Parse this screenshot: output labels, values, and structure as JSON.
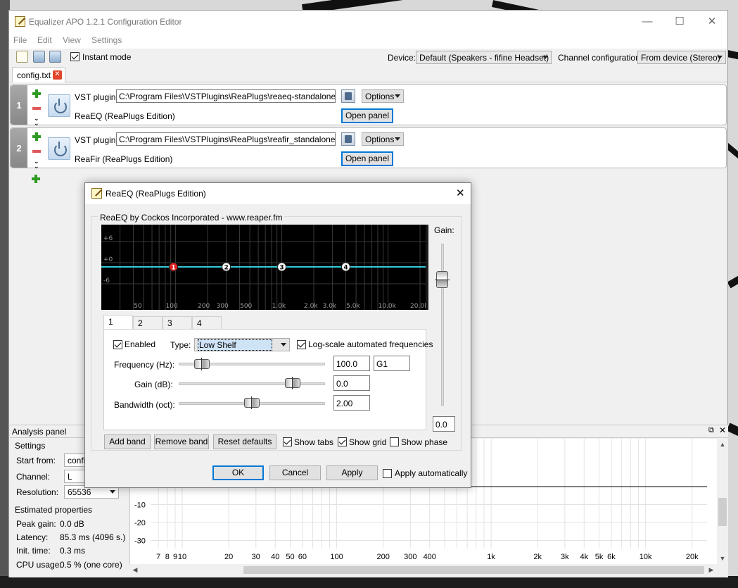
{
  "window": {
    "title": "Equalizer APO 1.2.1 Configuration Editor",
    "minimize": "—",
    "maximize": "☐",
    "close": "✕"
  },
  "menu": [
    "File",
    "Edit",
    "View",
    "Settings"
  ],
  "toolbar": {
    "instant_mode": "Instant mode",
    "instant_mode_checked": true,
    "device_label": "Device:",
    "device_value": "Default (Speakers - fifine Headset)",
    "channel_label": "Channel configuration:",
    "channel_value": "From device (Stereo)"
  },
  "file_tab": {
    "name": "config.txt",
    "close": "✕"
  },
  "plugins": [
    {
      "number": "1",
      "vst_label": "VST plugin:",
      "path": "C:\\Program Files\\VSTPlugins\\ReaPlugs\\reaeq-standalone.dll",
      "name": "ReaEQ (ReaPlugs Edition)",
      "options": "Options",
      "open_panel": "Open panel"
    },
    {
      "number": "2",
      "vst_label": "VST plugin:",
      "path": "C:\\Program Files\\VSTPlugins\\ReaPlugs\\reafir_standalone.dll",
      "name": "ReaFir (ReaPlugs Edition)",
      "options": "Options",
      "open_panel": "Open panel"
    }
  ],
  "analysis": {
    "title": "Analysis panel",
    "settings_label": "Settings",
    "start_from_label": "Start from:",
    "start_from_value": "config",
    "channel_label": "Channel:",
    "channel_value": "L",
    "resolution_label": "Resolution:",
    "resolution_value": "65536",
    "estimated_label": "Estimated properties",
    "peak_gain_label": "Peak gain:",
    "peak_gain_value": "0.0 dB",
    "latency_label": "Latency:",
    "latency_value": "85.3 ms (4096 s.)",
    "init_time_label": "Init. time:",
    "init_time_value": "0.3 ms",
    "cpu_label": "CPU usage:",
    "cpu_value": "0.5 % (one core)",
    "y_ticks": [
      "-10",
      "-20",
      "-30"
    ],
    "x_ticks": [
      "7",
      "8",
      "9",
      "10",
      "20",
      "30",
      "40",
      "50",
      "60",
      "100",
      "200",
      "300",
      "400",
      "1k",
      "2k",
      "3k",
      "4k",
      "5k",
      "6k",
      "10k",
      "20k"
    ]
  },
  "dialog": {
    "title": "ReaEQ (ReaPlugs Edition)",
    "group_label": "ReaEQ by Cockos Incorporated - www.reaper.fm",
    "gain_label": "Gain:",
    "gain_value": "0.0",
    "graph_y_labels": [
      "+6",
      "+0",
      "-6"
    ],
    "graph_x_labels": [
      "50",
      "100",
      "200",
      "300",
      "500",
      "1.0k",
      "2.0k",
      "3.0k",
      "5.0k",
      "10.0k",
      "20.0k"
    ],
    "band_points": [
      "1",
      "2",
      "3",
      "4"
    ],
    "tabs": [
      "1",
      "2",
      "3",
      "4"
    ],
    "enabled_label": "Enabled",
    "enabled_checked": true,
    "type_label": "Type:",
    "type_value": "Low Shelf",
    "log_scale_label": "Log-scale automated frequencies",
    "log_scale_checked": true,
    "frequency_label": "Frequency (Hz):",
    "frequency_value": "100.0",
    "note_value": "G1",
    "gain_db_label": "Gain (dB):",
    "gain_db_value": "0.0",
    "bandwidth_label": "Bandwidth (oct):",
    "bandwidth_value": "2.00",
    "add_band": "Add band",
    "remove_band": "Remove band",
    "reset_defaults": "Reset defaults",
    "show_tabs": "Show tabs",
    "show_tabs_checked": true,
    "show_grid": "Show grid",
    "show_grid_checked": true,
    "show_phase": "Show phase",
    "show_phase_checked": false,
    "ok": "OK",
    "cancel": "Cancel",
    "apply": "Apply",
    "apply_auto": "Apply automatically",
    "apply_auto_checked": false
  },
  "colors": {
    "eq_line": "#36c9d6",
    "band_active": "#e02020",
    "graph_bg": "#000000",
    "accent": "#0078d7"
  }
}
